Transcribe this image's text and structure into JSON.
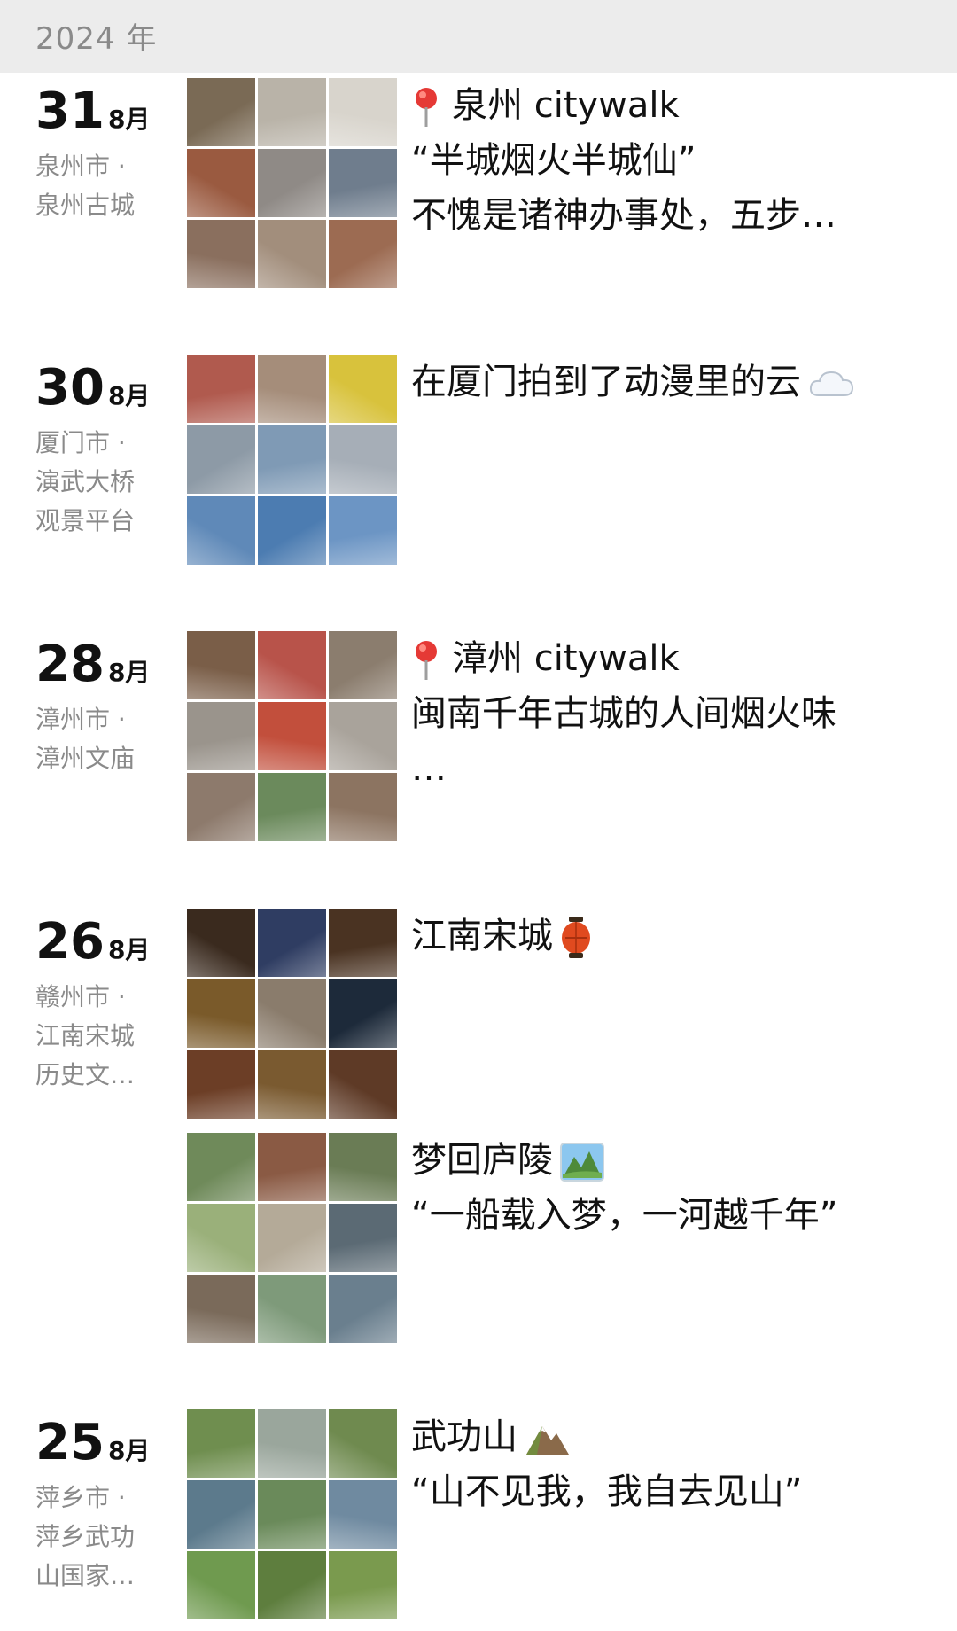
{
  "header": {
    "year": "2024 年"
  },
  "posts": [
    {
      "day": "31",
      "month": "8月",
      "location": [
        "泉州市 ·",
        "泉州古城"
      ],
      "caption_lines": [
        "泉州 citywalk",
        "“半城烟火半城仙”",
        "不愧是诸神办事处，五步…"
      ],
      "tiles": [
        "#7a6a55",
        "#b9b3a8",
        "#d8d4cc",
        "#9a5a40",
        "#8f8a86",
        "#6f7d8d",
        "#8a6f5e",
        "#a28e7c",
        "#9c6b52"
      ]
    },
    {
      "day": "30",
      "month": "8月",
      "location": [
        "厦门市 ·",
        "演武大桥",
        "观景平台"
      ],
      "caption_lines": [
        "在厦门拍到了动漫里的云"
      ],
      "tiles": [
        "#b05a4e",
        "#a58d7a",
        "#d8c23c",
        "#8d9aa6",
        "#7f9ab5",
        "#a6aeb7",
        "#5f89b8",
        "#4c7cb1",
        "#6c95c4"
      ]
    },
    {
      "day": "28",
      "month": "8月",
      "location": [
        "漳州市 ·",
        "漳州文庙"
      ],
      "caption_lines": [
        "漳州 citywalk",
        "闽南千年古城的人间烟火味",
        "…"
      ],
      "tiles": [
        "#7a5e48",
        "#b8534a",
        "#8b7d6e",
        "#9a948c",
        "#c24f3c",
        "#a9a39b",
        "#8d7a6c",
        "#6b8a5c",
        "#8c7461"
      ]
    },
    {
      "day": "26",
      "month": "8月",
      "location": [
        "赣州市 ·",
        "江南宋城",
        "历史文…"
      ],
      "caption_lines": [
        "江南宋城"
      ],
      "tiles": [
        "#3a2a1e",
        "#2f3d62",
        "#4a3322",
        "#7a5a2a",
        "#8a7c6c",
        "#1d2a3a",
        "#6c3e26",
        "#7a5a30",
        "#5e3a26"
      ]
    },
    {
      "caption_lines": [
        "梦回庐陵",
        "“一船载入梦，一河越千年”"
      ],
      "tiles": [
        "#6f8a5a",
        "#8a5a44",
        "#6a7c55",
        "#9ab07a",
        "#b4aa98",
        "#5b6a74",
        "#7a6a5a",
        "#7e9a7a",
        "#6a7f8e"
      ]
    },
    {
      "day": "25",
      "month": "8月",
      "location": [
        "萍乡市 ·",
        "萍乡武功",
        "山国家…"
      ],
      "caption_lines": [
        "武功山",
        "“山不见我，我自去见山”"
      ],
      "tiles": [
        "#6f8e4f",
        "#9aa69c",
        "#6f8a4f",
        "#5c7a8c",
        "#6a8a5a",
        "#6f8aa0",
        "#6f9a4f",
        "#5e7e3e",
        "#7a9a4e"
      ]
    }
  ]
}
